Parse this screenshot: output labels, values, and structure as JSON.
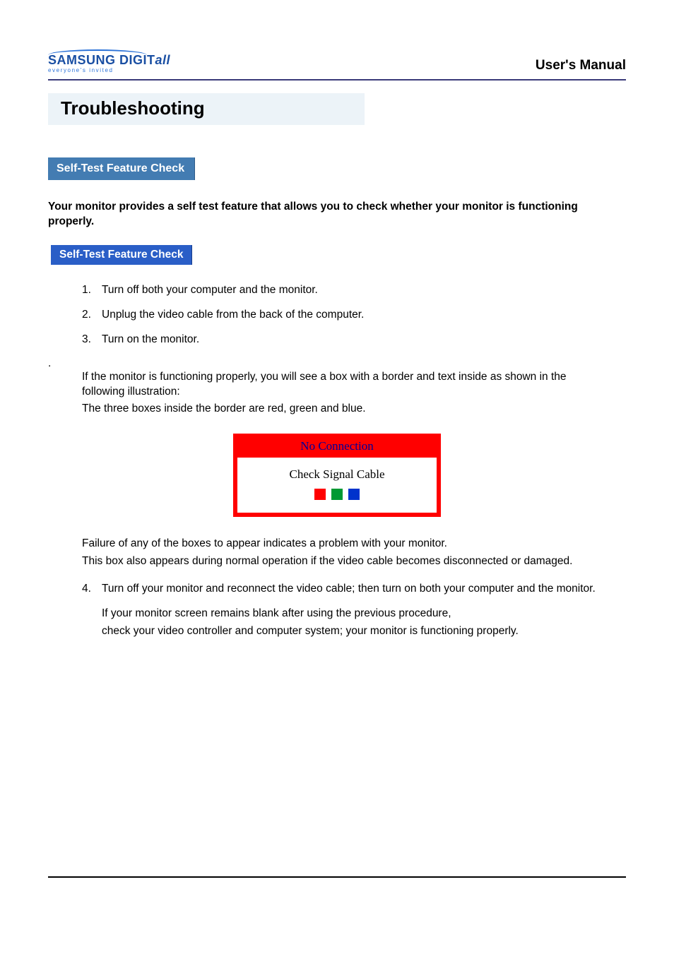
{
  "header": {
    "logo_main_1": "SAMSUNG DIGIT",
    "logo_main_2": "all",
    "logo_sub": "everyone's invited",
    "manual_title": "User's Manual"
  },
  "page_title": "Troubleshooting",
  "section1": {
    "heading": "Self-Test Feature Check",
    "intro": "Your monitor provides a self test feature that allows you to check whether your monitor is functioning properly."
  },
  "section2": {
    "heading": "Self-Test Feature Check",
    "steps": {
      "n1": "1.",
      "t1": "Turn off both your computer and the monitor.",
      "n2": "2.",
      "t2": "Unplug the video cable from the back of the computer.",
      "n3": "3.",
      "t3": "Turn on the monitor.",
      "n4": "4.",
      "t4": "Turn off your monitor and reconnect the video cable; then turn on both your computer and the monitor."
    },
    "dotline": ".",
    "para1": "If the monitor is functioning properly, you will see a box with a border and  text inside as shown in the following illustration:",
    "para1b": "The three boxes inside the border are red, green and blue.",
    "diagram": {
      "title": "No Connection",
      "subtitle": "Check Signal Cable"
    },
    "para2a": "Failure of any of the boxes to appear indicates a problem with your monitor.",
    "para2b": "This box also appears during normal operation if the video cable becomes disconnected or damaged.",
    "para3a": "If your monitor screen remains blank after using the previous procedure,",
    "para3b": "check your video controller and computer system; your monitor is functioning properly."
  }
}
